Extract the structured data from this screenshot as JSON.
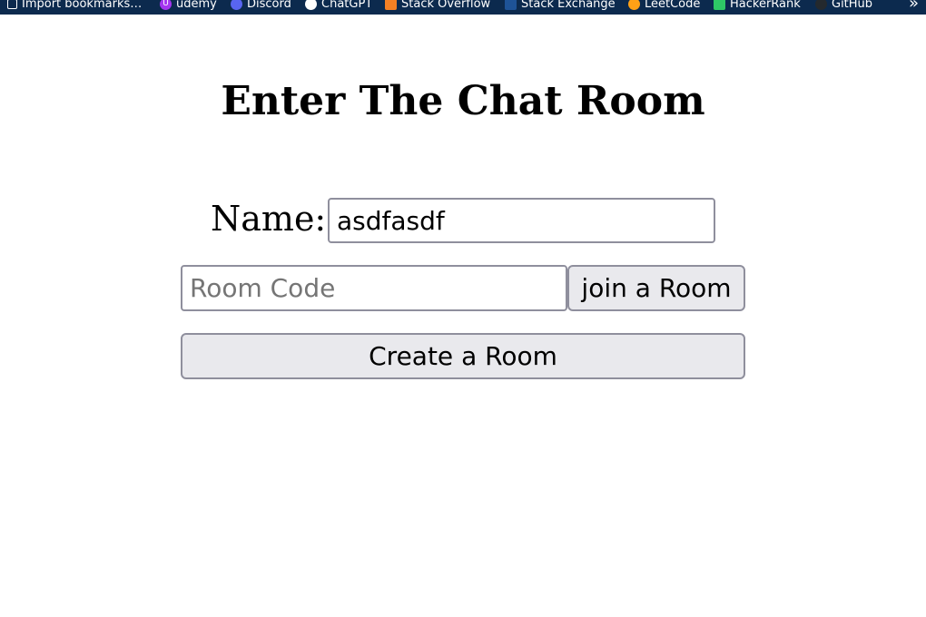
{
  "bookmarks": [
    {
      "label": "Import bookmarks…",
      "icon": "import-icon",
      "color": "#ffffff"
    },
    {
      "label": "udemy",
      "icon": "udemy-icon",
      "color": "#a435f0"
    },
    {
      "label": "Discord",
      "icon": "discord-icon",
      "color": "#5865f2"
    },
    {
      "label": "ChatGPT",
      "icon": "chatgpt-icon",
      "color": "#ffffff"
    },
    {
      "label": "Stack Overflow",
      "icon": "stackoverflow-icon",
      "color": "#f48024"
    },
    {
      "label": "Stack Exchange",
      "icon": "stackexchange-icon",
      "color": "#1e5397"
    },
    {
      "label": "LeetCode",
      "icon": "leetcode-icon",
      "color": "#ffa116"
    },
    {
      "label": "HackerRank",
      "icon": "hackerrank-icon",
      "color": "#2ec866"
    },
    {
      "label": "GitHub",
      "icon": "github-icon",
      "color": "#24292e"
    }
  ],
  "page": {
    "title": "Enter The Chat Room"
  },
  "form": {
    "name_label": "Name:",
    "name_value": "asdfasdf",
    "room_code_placeholder": "Room Code",
    "room_code_value": "",
    "join_label": "join a Room",
    "create_label": "Create a Room"
  },
  "colors": {
    "bookmarks_bar_bg": "#0c2a4e",
    "button_bg": "#e9e9ed",
    "input_border": "#8f8f9d"
  }
}
